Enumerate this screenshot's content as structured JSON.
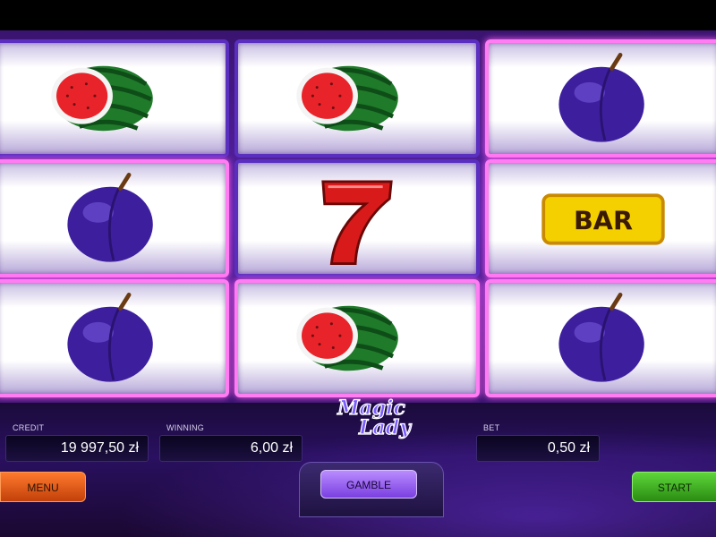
{
  "game": {
    "logo_text": "Magic Lady"
  },
  "reels": [
    [
      "watermelon",
      "plum",
      "plum"
    ],
    [
      "watermelon",
      "seven",
      "watermelon"
    ],
    [
      "plum",
      "bar",
      "plum"
    ]
  ],
  "symbol_labels": {
    "bar": "BAR",
    "seven": "7"
  },
  "hud": {
    "credit_label": "CREDIT",
    "credit_value": "19 997,50 zł",
    "winning_label": "WINNING",
    "winning_value": "6,00 zł",
    "bet_label": "BET",
    "bet_value": "0,50 zł"
  },
  "buttons": {
    "menu": "MENU",
    "gamble": "GAMBLE",
    "start": "START"
  },
  "colors": {
    "frame_purple": "#5a2fc0",
    "highlight_pink": "#ff7cf3",
    "menu_orange": "#e05a1a",
    "start_green": "#3fae22",
    "gamble_violet": "#9a66f0"
  }
}
